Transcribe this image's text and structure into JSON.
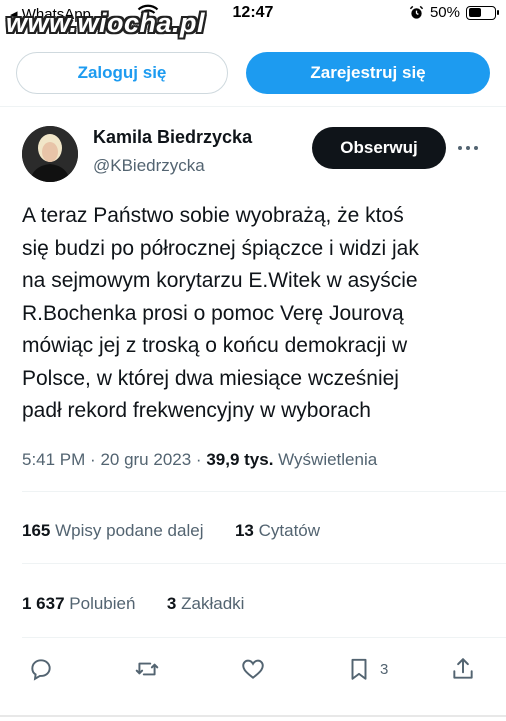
{
  "status_bar": {
    "back_label": "◂ WhatsApp",
    "time": "12:47",
    "battery": "50%",
    "battery_level": 0.5,
    "watermark": "www.wiocha.pl"
  },
  "auth": {
    "login_label": "Zaloguj się",
    "signup_label": "Zarejestruj się"
  },
  "author": {
    "name": "Kamila Biedrzycka",
    "handle": "@KBiedrzycka",
    "follow_label": "Obserwuj"
  },
  "tweet": {
    "lines": [
      "A teraz Państwo sobie wyobrażą, że ktoś",
      "się budzi po półrocznej śpiączce i widzi jak",
      "na sejmowym korytarzu E.Witek w asyście",
      "R.Bochenka prosi o pomoc Verę Jourovą",
      "mówiąc  jej z troską o końcu demokracji w",
      "Polsce, w której dwa miesiące wcześniej",
      "padł rekord frekwencyjny w wyborach"
    ],
    "time": "5:41 PM",
    "date": "20 gru 2023",
    "views_count": "39,9 tys.",
    "views_label": "Wyświetlenia"
  },
  "stats": {
    "reposts_count": "165",
    "reposts_label": "Wpisy podane dalej",
    "quotes_count": "13",
    "quotes_label": "Cytatów",
    "likes_count": "1 637",
    "likes_label": "Polubień",
    "bookmarks_count": "3",
    "bookmarks_label": "Zakładki"
  },
  "actions": {
    "bookmark_count": "3"
  },
  "colors": {
    "accent": "#1d9bf0",
    "text": "#0f1419",
    "secondary": "#536471"
  }
}
